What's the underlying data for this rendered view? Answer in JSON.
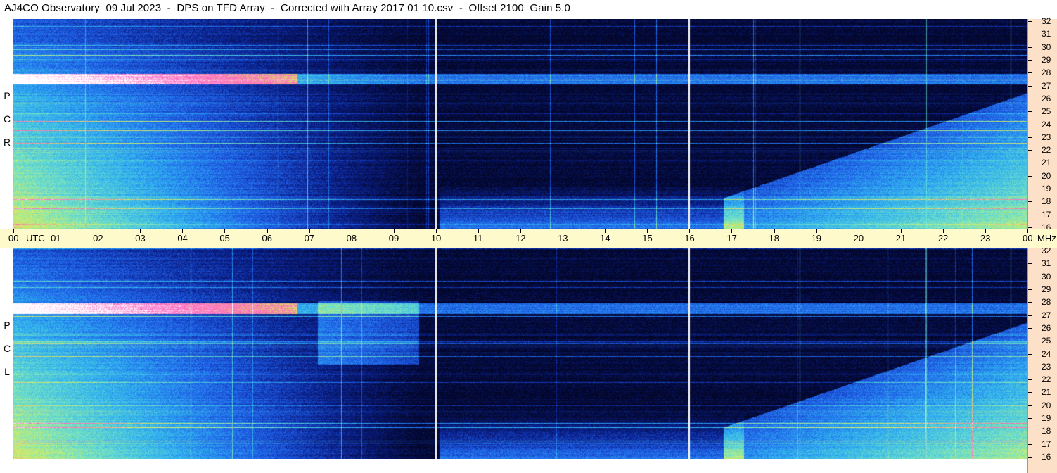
{
  "title": {
    "observatory": "AJ4CO Observatory",
    "date": "09 Jul 2023",
    "instrument": "DPS on TFD Array",
    "correction": "Corrected with Array 2017 01 10.csv",
    "offset": "Offset 2100",
    "gain": "Gain 5.0"
  },
  "chart_data": {
    "type": "heatmap",
    "x_axis": {
      "labels": [
        "00",
        "UTC",
        "01",
        "02",
        "03",
        "04",
        "05",
        "06",
        "07",
        "08",
        "09",
        "10",
        "11",
        "12",
        "13",
        "14",
        "15",
        "16",
        "17",
        "18",
        "19",
        "20",
        "21",
        "22",
        "23",
        "00",
        "MHz"
      ],
      "range_hours": [
        0,
        24
      ]
    },
    "y_axis": {
      "ticks": [
        "32",
        "31",
        "30",
        "29",
        "28",
        "27",
        "26",
        "25",
        "24",
        "23",
        "22",
        "21",
        "20",
        "19",
        "18",
        "17",
        "16"
      ],
      "range_mhz": [
        16,
        32
      ]
    },
    "panels": [
      {
        "name": "RCP",
        "letters": [
          "R",
          "C",
          "P"
        ]
      },
      {
        "name": "LCP",
        "letters": [
          "L",
          "C",
          "P"
        ]
      }
    ],
    "colormap": [
      "#030628",
      "#0a1f8a",
      "#1f5fe8",
      "#2fb0f0",
      "#6fe0c8",
      "#d8f060",
      "#ff60c0",
      "#ffffff"
    ]
  }
}
